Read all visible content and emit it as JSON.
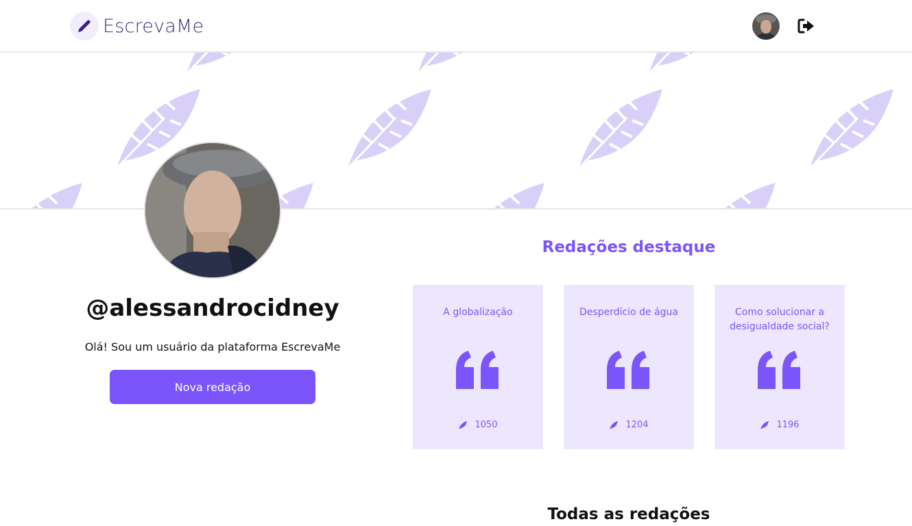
{
  "header": {
    "app_name": "EscrevaMe",
    "logo_icon": "pencil-icon",
    "logout_icon": "logout-icon"
  },
  "profile": {
    "username": "@alessandrocidney",
    "bio": "Olá! Sou um usuário da plataforma EscrevaMe",
    "new_button_label": "Nova redação"
  },
  "featured": {
    "title": "Redações destaque",
    "cards": [
      {
        "title": "A globalização",
        "views": "1050"
      },
      {
        "title": "Desperdício de água",
        "views": "1204"
      },
      {
        "title": "Como solucionar a desigualdade social?",
        "views": "1196"
      }
    ]
  },
  "all_essays": {
    "title": "Todas as redações"
  },
  "colors": {
    "accent": "#7b55fb",
    "card_bg": "#ede7fe",
    "feather": "#d9d0fa"
  }
}
